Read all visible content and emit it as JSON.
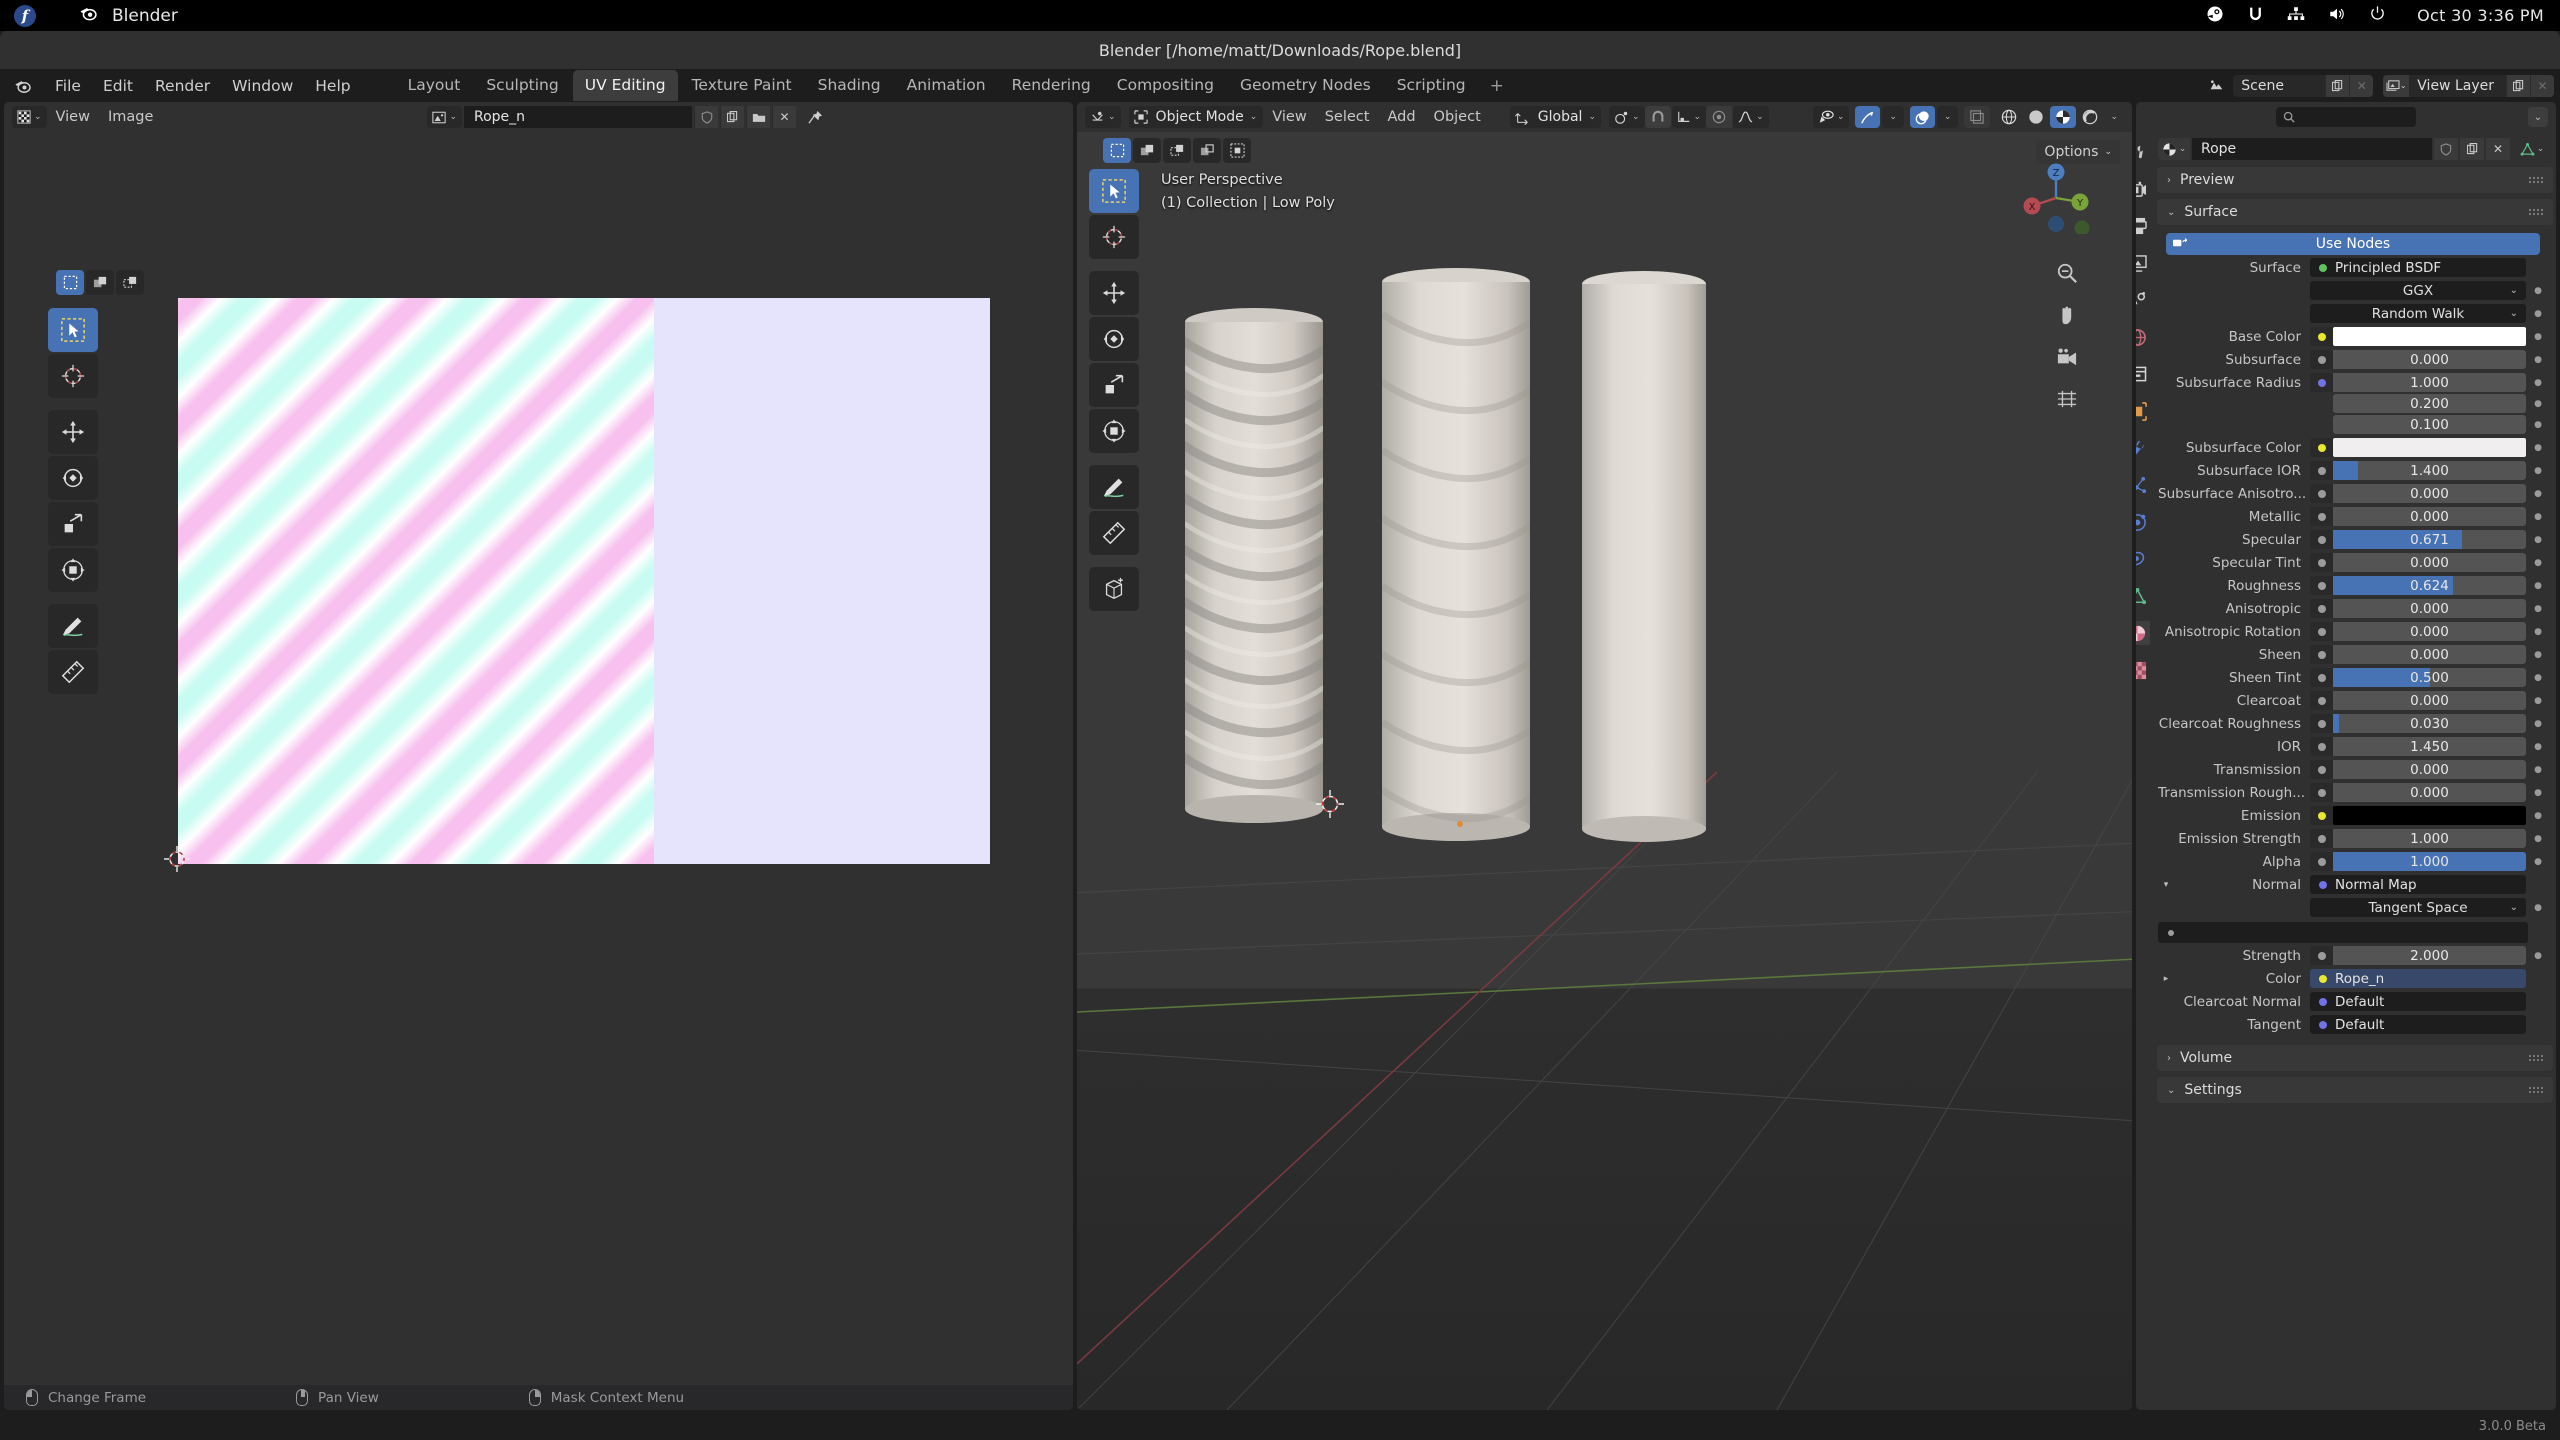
{
  "os_bar": {
    "app_name": "Blender",
    "logo": "fedora-logo",
    "tray_icons": [
      "steam-icon",
      "sync-icon",
      "network-icon",
      "volume-icon",
      "power-icon"
    ],
    "clock": "Oct 30  3:36 PM"
  },
  "window": {
    "title": "Blender [/home/matt/Downloads/Rope.blend]"
  },
  "topbar": {
    "menus": [
      "File",
      "Edit",
      "Render",
      "Window",
      "Help"
    ],
    "workspaces": [
      {
        "label": "Layout",
        "active": false
      },
      {
        "label": "Sculpting",
        "active": false
      },
      {
        "label": "UV Editing",
        "active": true
      },
      {
        "label": "Texture Paint",
        "active": false
      },
      {
        "label": "Shading",
        "active": false
      },
      {
        "label": "Animation",
        "active": false
      },
      {
        "label": "Rendering",
        "active": false
      },
      {
        "label": "Compositing",
        "active": false
      },
      {
        "label": "Geometry Nodes",
        "active": false
      },
      {
        "label": "Scripting",
        "active": false
      }
    ],
    "add_workspace": "+",
    "scene_name": "Scene",
    "view_layer_name": "View Layer"
  },
  "uv_editor": {
    "editor_type_icon": "uv-editor-icon",
    "menus": [
      "View",
      "Image"
    ],
    "image_name": "Rope_n",
    "image_icon": "image-icon",
    "buttons": [
      "shield-icon",
      "duplicate-icon",
      "folder-icon",
      "close-icon",
      "pin-icon"
    ],
    "select_modes": [
      "select-box-icon",
      "select-face-icon",
      "select-island-icon"
    ],
    "tools": [
      "tweak-tool-icon",
      "cursor-tool-icon",
      "move-tool-icon",
      "rotate-tool-icon",
      "scale-tool-icon",
      "transform-tool-icon",
      "annotate-tool-icon",
      "measure-tool-icon"
    ],
    "status_bar": [
      {
        "mouse": "left",
        "label": "Change Frame"
      },
      {
        "mouse": "middle",
        "label": "Pan View"
      },
      {
        "mouse": "right",
        "label": "Mask Context Menu"
      }
    ]
  },
  "viewport": {
    "mode": "Object Mode",
    "menus": [
      "View",
      "Select",
      "Add",
      "Object"
    ],
    "transform_orientation": "Global",
    "options_label": "Options",
    "overlay_text_line1": "User Perspective",
    "overlay_text_line2": "(1) Collection | Low Poly",
    "select_modes": [
      "select-box-icon",
      "select-extend-icon",
      "select-subtract-icon",
      "select-invert-icon",
      "select-intersect-icon"
    ],
    "tools": [
      "tweak-tool-icon",
      "cursor-tool-icon",
      "move-tool-icon",
      "rotate-tool-icon",
      "scale-tool-icon",
      "transform-tool-icon",
      "annotate-tool-icon",
      "measure-tool-icon",
      "add-cube-tool-icon"
    ],
    "gizmo_axes": [
      "Z",
      "X",
      "Y"
    ],
    "side_buttons": [
      "zoom-icon",
      "hand-icon",
      "camera-icon",
      "grid-icon"
    ],
    "shading_modes": [
      "wireframe-icon",
      "solid-icon",
      "material-preview-icon",
      "rendered-icon"
    ],
    "active_shading": "material-preview-icon"
  },
  "properties": {
    "search_placeholder": "",
    "tabs": [
      "tool-icon",
      "render-icon",
      "output-icon",
      "view-layer-icon",
      "scene-icon",
      "world-icon",
      "collection-icon",
      "object-icon",
      "modifier-icon",
      "particles-icon",
      "physics-icon",
      "constraints-icon",
      "data-icon",
      "material-icon",
      "texture-icon"
    ],
    "active_tab": "material-icon",
    "material_name": "Rope",
    "material_icon": "material-sphere-icon",
    "panels": [
      {
        "label": "Preview",
        "expanded": false
      },
      {
        "label": "Surface",
        "expanded": true
      },
      {
        "label": "Volume",
        "expanded": false
      },
      {
        "label": "Settings",
        "expanded": true
      }
    ],
    "use_nodes_label": "Use Nodes",
    "surface_label": "Surface",
    "surface_value": "Principled BSDF",
    "distribution": "GGX",
    "subsurface_method": "Random Walk",
    "rows": [
      {
        "label": "Base Color",
        "type": "color",
        "color": "#ffffff",
        "socket": "yellow"
      },
      {
        "label": "Subsurface",
        "type": "slider",
        "value": "0.000",
        "fill": 0,
        "socket": "gray"
      },
      {
        "label": "Subsurface Radius",
        "type": "slider",
        "value": "1.000",
        "fill": 0,
        "socket": "purple"
      },
      {
        "label": "",
        "type": "slider",
        "value": "0.200",
        "fill": 0,
        "socket": "none"
      },
      {
        "label": "",
        "type": "slider",
        "value": "0.100",
        "fill": 0,
        "socket": "none"
      },
      {
        "label": "Subsurface Color",
        "type": "color",
        "color": "#f0eeee",
        "socket": "yellow"
      },
      {
        "label": "Subsurface IOR",
        "type": "slider",
        "value": "1.400",
        "fill": 13,
        "socket": "gray"
      },
      {
        "label": "Subsurface Anisotro...",
        "type": "slider",
        "value": "0.000",
        "fill": 0,
        "socket": "gray"
      },
      {
        "label": "Metallic",
        "type": "slider",
        "value": "0.000",
        "fill": 0,
        "socket": "gray"
      },
      {
        "label": "Specular",
        "type": "slider",
        "value": "0.671",
        "fill": 67,
        "socket": "gray"
      },
      {
        "label": "Specular Tint",
        "type": "slider",
        "value": "0.000",
        "fill": 0,
        "socket": "gray"
      },
      {
        "label": "Roughness",
        "type": "slider",
        "value": "0.624",
        "fill": 62,
        "socket": "gray"
      },
      {
        "label": "Anisotropic",
        "type": "slider",
        "value": "0.000",
        "fill": 0,
        "socket": "gray"
      },
      {
        "label": "Anisotropic Rotation",
        "type": "slider",
        "value": "0.000",
        "fill": 0,
        "socket": "gray"
      },
      {
        "label": "Sheen",
        "type": "slider",
        "value": "0.000",
        "fill": 0,
        "socket": "gray"
      },
      {
        "label": "Sheen Tint",
        "type": "slider",
        "value": "0.500",
        "fill": 50,
        "socket": "gray"
      },
      {
        "label": "Clearcoat",
        "type": "slider",
        "value": "0.000",
        "fill": 0,
        "socket": "gray"
      },
      {
        "label": "Clearcoat Roughness",
        "type": "slider",
        "value": "0.030",
        "fill": 3,
        "socket": "gray"
      },
      {
        "label": "IOR",
        "type": "slider",
        "value": "1.450",
        "fill": 0,
        "socket": "gray"
      },
      {
        "label": "Transmission",
        "type": "slider",
        "value": "0.000",
        "fill": 0,
        "socket": "gray"
      },
      {
        "label": "Transmission Rough...",
        "type": "slider",
        "value": "0.000",
        "fill": 0,
        "socket": "gray"
      },
      {
        "label": "Emission",
        "type": "color",
        "color": "#000000",
        "socket": "yellow"
      },
      {
        "label": "Emission Strength",
        "type": "slider",
        "value": "1.000",
        "fill": 0,
        "socket": "gray"
      },
      {
        "label": "Alpha",
        "type": "slider",
        "value": "1.000",
        "fill": 100,
        "socket": "gray"
      }
    ],
    "normal_label": "Normal",
    "normal_value": "Normal Map",
    "normal_space": "Tangent Space",
    "strength_label": "Strength",
    "strength_value": "2.000",
    "color_label": "Color",
    "color_value": "Rope_n",
    "clearcoat_normal_label": "Clearcoat Normal",
    "clearcoat_normal_value": "Default",
    "tangent_label": "Tangent",
    "tangent_value": "Default",
    "version": "3.0.0 Beta"
  },
  "colors": {
    "accent_blue": "#4772b3",
    "panel_bg": "#303030",
    "window_bg": "#1d1d1d",
    "field_bg": "#545454",
    "text": "#c6c6c6"
  }
}
